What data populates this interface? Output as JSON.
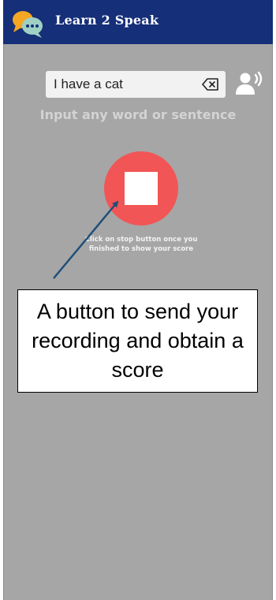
{
  "header": {
    "title": "Learn 2 Speak",
    "logo_icon": "speech-bubbles-icon"
  },
  "input": {
    "value": "I have a cat",
    "clear_icon": "backspace-clear-icon"
  },
  "speaker_icon": "speaker-audio-icon",
  "hint": "Input any word or sentence",
  "stop_button": {
    "icon": "stop-icon",
    "color": "#f25555"
  },
  "instruction": "Click on stop button once you finished to show your score",
  "callout": {
    "text": "A button to send your recording and obtain a score"
  },
  "colors": {
    "header_bg": "#152f78",
    "screen_bg": "#a6a6a6",
    "arrow": "#1f4e79"
  }
}
